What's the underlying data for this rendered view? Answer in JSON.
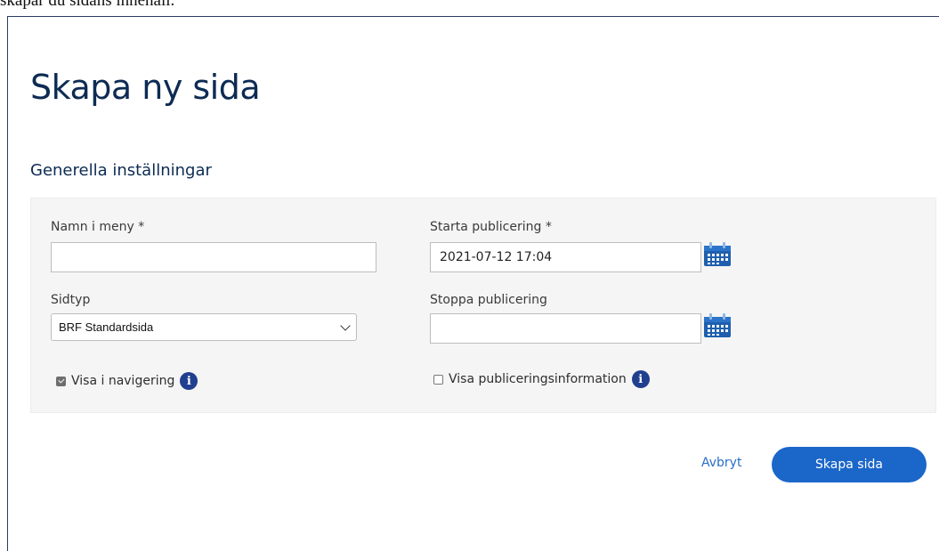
{
  "top_snippet": "skapar du sidans innehåll.",
  "page": {
    "title": "Skapa ny sida"
  },
  "general_settings": {
    "heading": "Generella inställningar",
    "menu_name": {
      "label": "Namn i meny *",
      "value": ""
    },
    "page_type": {
      "label": "Sidtyp",
      "selected": "BRF Standardsida"
    },
    "show_in_nav": {
      "label": "Visa i navigering",
      "checked": true
    },
    "start_publish": {
      "label": "Starta publicering *",
      "value": "2021-07-12 17:04"
    },
    "stop_publish": {
      "label": "Stoppa publicering",
      "value": ""
    },
    "show_publish_info": {
      "label": "Visa publiceringsinformation",
      "checked": false
    }
  },
  "actions": {
    "cancel_label": "Avbryt",
    "create_label": "Skapa sida"
  },
  "colors": {
    "title": "#0d2b53",
    "primary_button": "#1b66c9",
    "link": "#2a6ec8",
    "info_icon": "#203f8e",
    "panel_bg": "#f5f5f5"
  },
  "icons": {
    "calendar": "calendar-icon",
    "info": "info-icon",
    "dropdown": "chevron-down-icon"
  }
}
